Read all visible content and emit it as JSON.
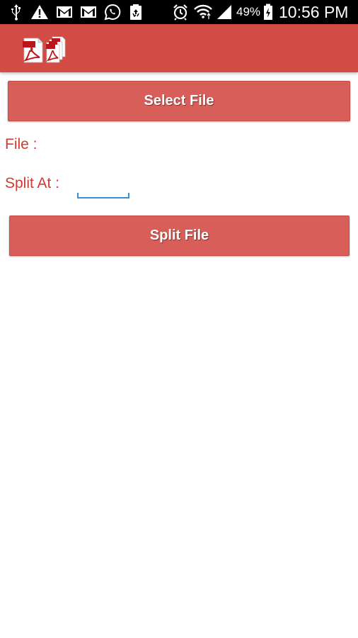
{
  "status_bar": {
    "battery_percent": "49%",
    "time": "10:56 PM",
    "icons": [
      "usb-icon",
      "warning-icon",
      "gmail-icon",
      "gmail-icon",
      "whatsapp-icon",
      "recycle-icon",
      "alarm-icon",
      "wifi-icon",
      "signal-icon",
      "battery-icon"
    ]
  },
  "app_bar": {
    "logo": "pdf-split-logo",
    "logo_text": "PDF",
    "color": "#d24b45"
  },
  "main": {
    "select_file_label": "Select File",
    "file_label": "File :",
    "split_at_label": "Split At :",
    "split_at_value": "",
    "split_file_label": "Split File"
  },
  "colors": {
    "button": "#d85e59",
    "label_text": "#d03a33",
    "input_underline": "#3a8fd6"
  }
}
